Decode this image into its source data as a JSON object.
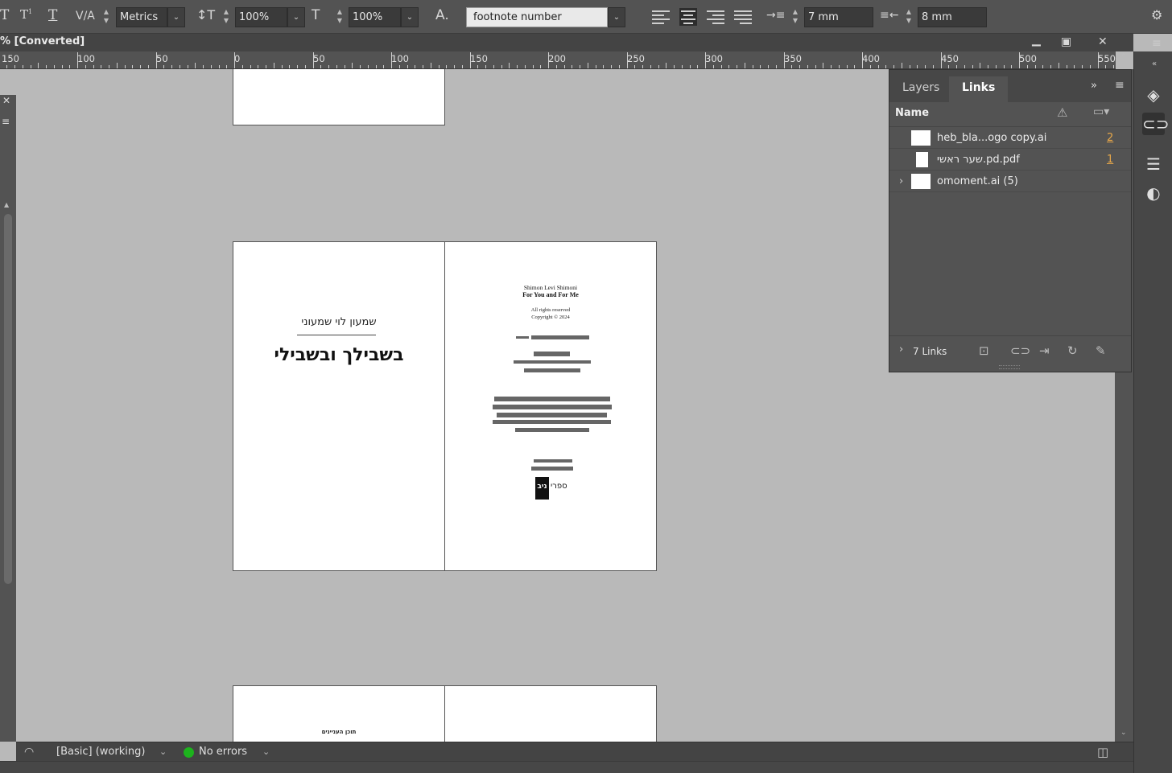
{
  "toolbar": {
    "kerning_value": "Metrics",
    "vertical_scale": "100%",
    "horizontal_scale": "100%",
    "char_style": "footnote number",
    "left_indent": "7 mm",
    "right_indent": "8 mm"
  },
  "document": {
    "title": "% [Converted]"
  },
  "ruler": {
    "labels": [
      "150",
      "100",
      "50",
      "0",
      "50",
      "100",
      "150",
      "200",
      "250",
      "300",
      "350",
      "400",
      "450",
      "500",
      "550"
    ]
  },
  "spread_left": {
    "author": "שמעון לוי שמעוני",
    "book_title": "בשבילך ובשבילי"
  },
  "spread_right": {
    "author_en": "Shimon Levi Shimoni",
    "title_en": "For You and For Me",
    "rights": "All rights reserved",
    "copyright": "Copyright © 2024",
    "publisher_logo_text": "ספרי",
    "publisher_logo_mark": "ניב"
  },
  "bottom_page": {
    "toc_label": "תוכן העניינים"
  },
  "links_panel": {
    "tabs": [
      "Layers",
      "Links"
    ],
    "active_tab": "Links",
    "name_header": "Name",
    "items": [
      {
        "name": "heb_bla...ogo copy.ai",
        "page": "2"
      },
      {
        "name": "שער ראשי.pd.pdf",
        "page": "1"
      },
      {
        "name": "omoment.ai (5)",
        "page": ""
      }
    ],
    "footer_count": "7 Links"
  },
  "status": {
    "profile": "[Basic] (working)",
    "errors": "No errors",
    "ok_color": "#1db31d"
  }
}
